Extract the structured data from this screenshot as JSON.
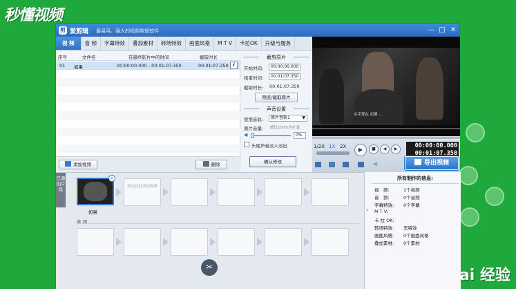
{
  "watermark": {
    "top_left": "秒懂视频",
    "bottom_right": "Bai 经验"
  },
  "window": {
    "app_name": "爱剪辑",
    "slogan": "最易用、强大的视频剪辑软件",
    "controls": [
      "—",
      "□",
      "✕"
    ]
  },
  "tabs": [
    "视 频",
    "音 频",
    "字幕特效",
    "叠加素材",
    "转场特效",
    "画面风格",
    "M T V",
    "卡拉OK",
    "升级与服务"
  ],
  "clip_list": {
    "headers": [
      "序号",
      "文件名",
      "在最终影片中的时间",
      "截取时长"
    ],
    "rows": [
      {
        "index": "01",
        "name": "如果",
        "time": "00:00:00.000 - 00:01:07.350",
        "duration": "00:01:07.350"
      }
    ],
    "add_button": "添加视频",
    "delete_button": "删除"
  },
  "settings": {
    "clip_title": "截剪原片",
    "start_label": "开始时间:",
    "start_value": "00:00:00.000",
    "end_label": "结束时间:",
    "end_value": "00:01:07.350",
    "duration_label": "截取时长:",
    "duration_value": "00:01:07.350",
    "preview_button": "预览/截取原片",
    "audio_title": "声音设置",
    "track_label": "使用音轨:",
    "track_value": "原片音轨1",
    "volume_label": "原片音量:",
    "volume_hint": "超过100%为扩音",
    "volume_value": "0%",
    "fade_label": "头尾声音淡入淡出",
    "confirm_button": "确认修改"
  },
  "player": {
    "subtitle": "合乎现在 如果 ...",
    "speeds": [
      "1/2X",
      "1X",
      "2X"
    ],
    "time_current": "00:00:00.000",
    "time_total": "00:01:07.350",
    "export_button": "导出视频"
  },
  "timeline": {
    "side_tab": "已添加片段",
    "clip_name": "如果",
    "placeholder": "双击此处添加视频",
    "audio_label": "音 频"
  },
  "info_panel": {
    "title": "所有制作的信息:",
    "rows": [
      {
        "k": "视　频:",
        "v": "1个视频"
      },
      {
        "k": "音　频:",
        "v": "0个音频"
      },
      {
        "k": "字幕特效:",
        "v": "0个字幕"
      },
      {
        "k": "M T V:",
        "v": ""
      },
      {
        "k": "卡 拉 OK:",
        "v": ""
      },
      {
        "k": "转场特效:",
        "v": "无特效"
      },
      {
        "k": "画面风格:",
        "v": "0个画面风格"
      },
      {
        "k": "叠加素材:",
        "v": "0个素材"
      }
    ]
  },
  "colors": {
    "background": "#1fa83c",
    "accent": "#2c70c8",
    "selected_row": "#cfe3f8"
  }
}
